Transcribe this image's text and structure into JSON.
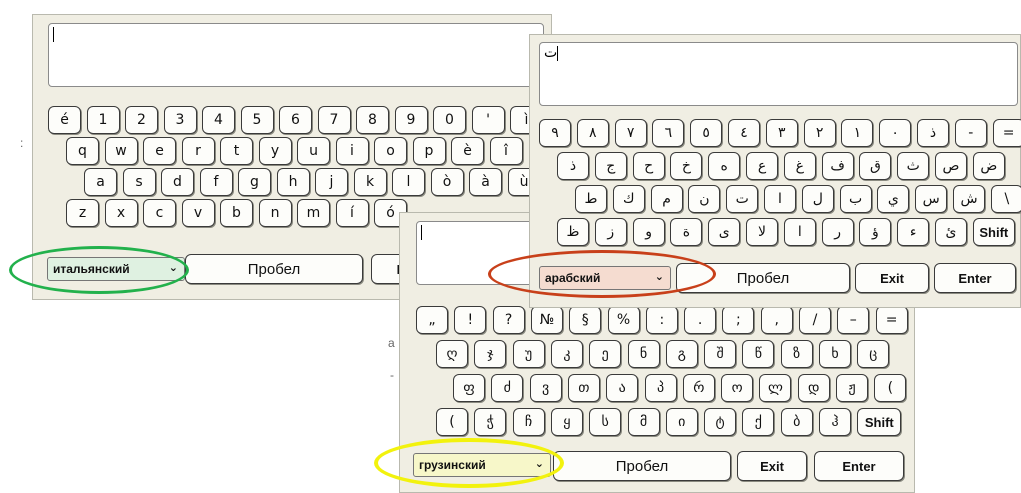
{
  "italian": {
    "language": "итальянский",
    "space_label": "Пробел",
    "partial_key": "E",
    "rows": [
      [
        "é",
        "1",
        "2",
        "3",
        "4",
        "5",
        "6",
        "7",
        "8",
        "9",
        "0",
        "'",
        "ì"
      ],
      [
        "q",
        "w",
        "e",
        "r",
        "t",
        "y",
        "u",
        "i",
        "o",
        "p",
        "è",
        "î"
      ],
      [
        "a",
        "s",
        "d",
        "f",
        "g",
        "h",
        "j",
        "k",
        "l",
        "ò",
        "à",
        "ù"
      ],
      [
        "z",
        "x",
        "c",
        "v",
        "b",
        "n",
        "m",
        "í",
        "ó"
      ]
    ]
  },
  "arabic": {
    "language": "арабский",
    "text_value": "ت",
    "space_label": "Пробел",
    "exit_label": "Exit",
    "enter_label": "Enter",
    "rows": [
      [
        "٩",
        "٨",
        "٧",
        "٦",
        "٥",
        "٤",
        "٣",
        "٢",
        "١",
        "٠",
        "ذ",
        "-",
        "="
      ],
      [
        "ذ",
        "ج",
        "ح",
        "خ",
        "ه",
        "ع",
        "غ",
        "ف",
        "ق",
        "ث",
        "ص",
        "ض"
      ],
      [
        "ط",
        "ك",
        "م",
        "ن",
        "ت",
        "ا",
        "ل",
        "ب",
        "ي",
        "س",
        "ش",
        "\\"
      ],
      [
        "ظ",
        "ز",
        "و",
        "ة",
        "ى",
        "ﻻ",
        "ا",
        "ر",
        "ؤ",
        "ء",
        "ئ",
        "Shift"
      ]
    ]
  },
  "georgian": {
    "language": "грузинский",
    "space_label": "Пробел",
    "exit_label": "Exit",
    "enter_label": "Enter",
    "rows": [
      [
        "„",
        "!",
        "?",
        "№",
        "§",
        "%",
        ":",
        ".",
        ";",
        ",",
        "/",
        "–",
        "="
      ],
      [
        "ღ",
        "ჯ",
        "უ",
        "კ",
        "ე",
        "ნ",
        "გ",
        "შ",
        "წ",
        "ზ",
        "ხ",
        "ც"
      ],
      [
        "ფ",
        "ძ",
        "ვ",
        "თ",
        "ა",
        "პ",
        "რ",
        "ო",
        "ლ",
        "დ",
        "ჟ",
        "("
      ],
      [
        "(",
        "ჭ",
        "ჩ",
        "ყ",
        "ს",
        "მ",
        "ი",
        "ტ",
        "ქ",
        "ბ",
        "ჰ",
        "Shift"
      ]
    ]
  },
  "highlight_colors": {
    "italian": "#22b14c",
    "arabic": "#c8401a",
    "georgian": "#f2f20d"
  }
}
